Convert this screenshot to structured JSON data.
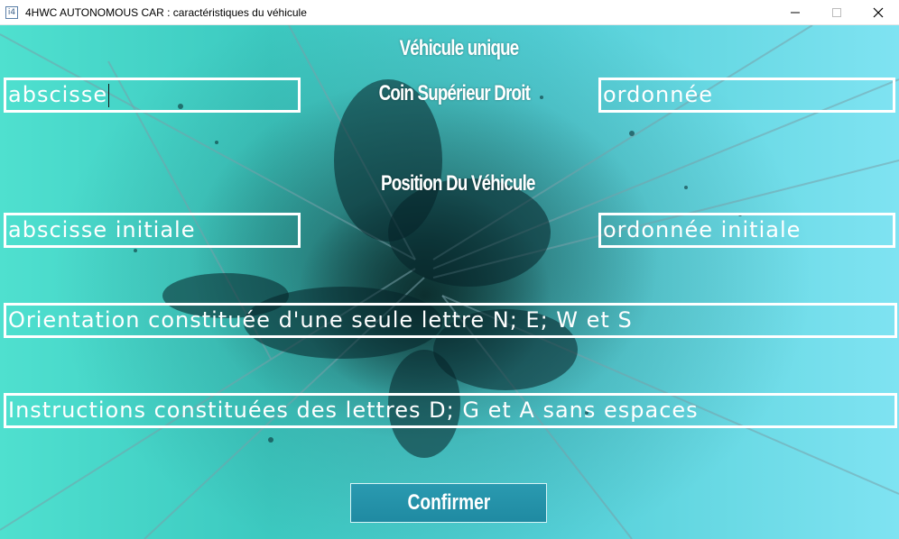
{
  "window": {
    "icon_glyph": "i4",
    "title": "4HWC AUTONOMOUS CAR : caractéristiques du véhicule",
    "controls": [
      "minimize-icon",
      "maximize-icon",
      "close-icon"
    ]
  },
  "headings": {
    "vehicle": "Véhicule unique",
    "corner": "Coin Supérieur Droit",
    "position": "Position Du Véhicule"
  },
  "fields": {
    "corner_x": "abscisse",
    "corner_y": "ordonnée",
    "initial_x": "abscisse initiale",
    "initial_y": "ordonnée initiale",
    "orientation": "Orientation constituée d'une seule lettre N; E; W et S",
    "instructions": "Instructions constituées des lettres D; G et A sans espaces"
  },
  "buttons": {
    "confirm": "Confirmer"
  },
  "colors": {
    "accent_cyan": "#3cc9c0",
    "button": "#2a9ab0",
    "text": "#ffffff"
  }
}
